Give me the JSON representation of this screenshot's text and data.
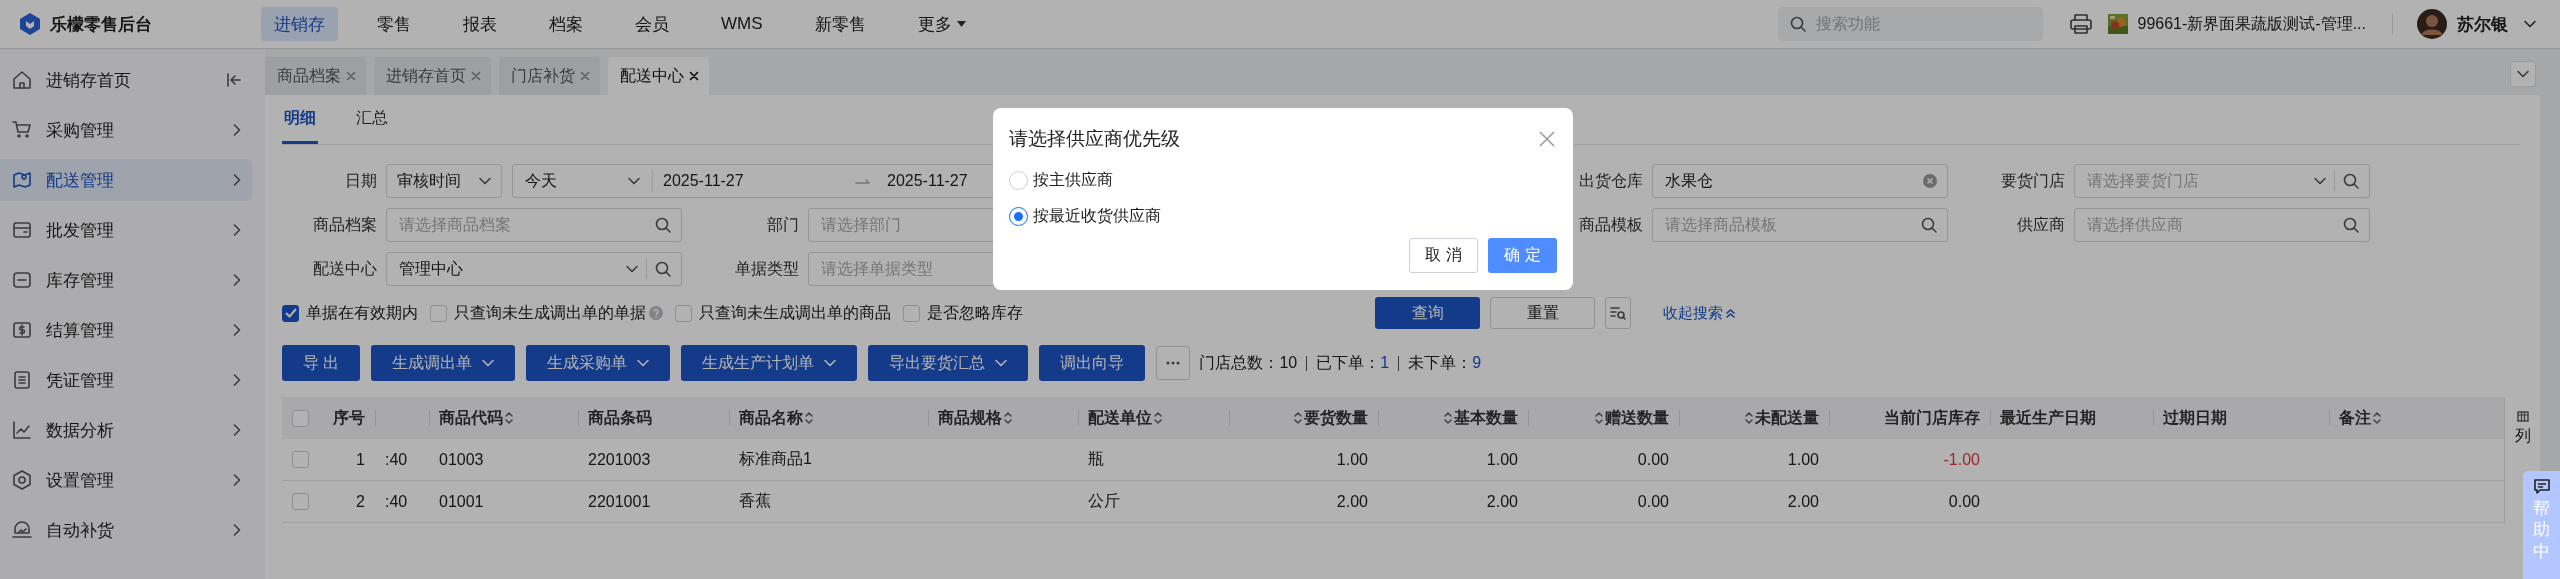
{
  "brand": {
    "name": "乐檬零售后台"
  },
  "top_nav": [
    {
      "label": "进销存",
      "selected": true,
      "caret": false
    },
    {
      "label": "零售",
      "selected": false,
      "caret": false
    },
    {
      "label": "报表",
      "selected": false,
      "caret": false
    },
    {
      "label": "档案",
      "selected": false,
      "caret": false
    },
    {
      "label": "会员",
      "selected": false,
      "caret": false
    },
    {
      "label": "WMS",
      "selected": false,
      "caret": false
    },
    {
      "label": "新零售",
      "selected": false,
      "caret": false
    },
    {
      "label": "更多",
      "selected": false,
      "caret": true
    }
  ],
  "search": {
    "placeholder": "搜索功能"
  },
  "store": {
    "name": "99661-新界面果蔬版测试-管理..."
  },
  "user": {
    "name": "苏尔银"
  },
  "sidebar": {
    "items": [
      {
        "label": "进销存首页",
        "selected": false,
        "kind": "home"
      },
      {
        "label": "采购管理",
        "selected": false,
        "kind": "cart"
      },
      {
        "label": "配送管理",
        "selected": true,
        "kind": "map"
      },
      {
        "label": "批发管理",
        "selected": false,
        "kind": "wallet"
      },
      {
        "label": "库存管理",
        "selected": false,
        "kind": "stock"
      },
      {
        "label": "结算管理",
        "selected": false,
        "kind": "money"
      },
      {
        "label": "凭证管理",
        "selected": false,
        "kind": "doc"
      },
      {
        "label": "数据分析",
        "selected": false,
        "kind": "chart"
      },
      {
        "label": "设置管理",
        "selected": false,
        "kind": "settings"
      },
      {
        "label": "自动补货",
        "selected": false,
        "kind": "auto"
      }
    ]
  },
  "page_tabs": [
    {
      "label": "商品档案",
      "selected": false
    },
    {
      "label": "进销存首页",
      "selected": false
    },
    {
      "label": "门店补货",
      "selected": false
    },
    {
      "label": "配送中心",
      "selected": true
    }
  ],
  "sub_tabs": [
    {
      "label": "明细",
      "selected": true
    },
    {
      "label": "汇总",
      "selected": false
    }
  ],
  "filter_rows": [
    {
      "left": [
        {
          "label": "日期",
          "kind": "date-range",
          "mode": "审核时间",
          "preset": "今天",
          "start": "2025-11-27",
          "end": "2025-11-27"
        }
      ],
      "right": [
        {
          "label": "出货仓库",
          "kind": "clearable",
          "value": "水果仓"
        },
        {
          "label": "要货门店",
          "kind": "select-search",
          "placeholder": "请选择要货门店"
        }
      ]
    },
    {
      "left": [
        {
          "label": "商品档案",
          "kind": "search",
          "placeholder": "请选择商品档案"
        },
        {
          "label": "部门",
          "kind": "text",
          "placeholder": "请选择部门"
        }
      ],
      "right": [
        {
          "label": "商品模板",
          "kind": "search",
          "placeholder": "请选择商品模板"
        },
        {
          "label": "供应商",
          "kind": "search",
          "placeholder": "请选择供应商"
        }
      ]
    },
    {
      "left": [
        {
          "label": "配送中心",
          "kind": "select-search",
          "value": "管理中心"
        },
        {
          "label": "单据类型",
          "kind": "text",
          "placeholder": "请选择单据类型"
        }
      ],
      "right": []
    }
  ],
  "options": [
    {
      "label": "单据在有效期内",
      "checked": true,
      "help": false
    },
    {
      "label": "只查询未生成调出单的单据",
      "checked": false,
      "help": true
    },
    {
      "label": "只查询未生成调出单的商品",
      "checked": false,
      "help": false
    },
    {
      "label": "是否忽略库存",
      "checked": false,
      "help": false
    }
  ],
  "search_actions": {
    "query": "查询",
    "reset": "重置",
    "collapse": "收起搜索"
  },
  "actions": [
    {
      "label": "导 出",
      "dropdown": false
    },
    {
      "label": "生成调出单",
      "dropdown": true
    },
    {
      "label": "生成采购单",
      "dropdown": true
    },
    {
      "label": "生成生产计划单",
      "dropdown": true
    },
    {
      "label": "导出要货汇总",
      "dropdown": true
    },
    {
      "label": "调出向导",
      "dropdown": false
    }
  ],
  "summary": [
    {
      "label": "门店总数：",
      "value": "10",
      "highlight": false
    },
    {
      "label": "已下单：",
      "value": "1",
      "highlight": true
    },
    {
      "label": "未下单：",
      "value": "9",
      "highlight": true
    }
  ],
  "table": {
    "select_all": {
      "checked": false
    },
    "columns": [
      {
        "label": "序号",
        "kind": "index",
        "sortable": false
      },
      {
        "kind": "text",
        "sortable": false
      },
      {
        "label": "商品代码",
        "kind": "text",
        "sortable": true
      },
      {
        "label": "商品条码",
        "kind": "text",
        "sortable": false
      },
      {
        "label": "商品名称",
        "kind": "text",
        "sortable": true
      },
      {
        "label": "商品规格",
        "kind": "text",
        "sortable": true
      },
      {
        "label": "配送单位",
        "kind": "text",
        "sortable": true
      },
      {
        "label": "要货数量",
        "kind": "number",
        "sortable": true
      },
      {
        "label": "基本数量",
        "kind": "number",
        "sortable": true
      },
      {
        "label": "赠送数量",
        "kind": "number",
        "sortable": true
      },
      {
        "label": "未配送量",
        "kind": "number",
        "sortable": true
      },
      {
        "label": "当前门店库存",
        "kind": "stock",
        "sortable": false
      },
      {
        "label": "最近生产日期",
        "kind": "text",
        "sortable": false
      },
      {
        "label": "过期日期",
        "kind": "text",
        "sortable": false
      },
      {
        "label": "备注",
        "kind": "text",
        "sortable": true
      }
    ],
    "rows": [
      {
        "checked": false,
        "stock_alert": true,
        "cells": [
          "1",
          ":40",
          "01003",
          "2201003",
          "标准商品1",
          null,
          "瓶",
          "1.00",
          "1.00",
          "0.00",
          "1.00",
          "-1.00",
          null,
          null,
          null
        ]
      },
      {
        "checked": false,
        "stock_alert": false,
        "cells": [
          "2",
          ":40",
          "01001",
          "2201001",
          "香蕉",
          null,
          "公斤",
          "2.00",
          "2.00",
          "0.00",
          "2.00",
          "0.00",
          null,
          null,
          null
        ]
      }
    ]
  },
  "column_button": {
    "label": "列"
  },
  "help": {
    "label": "帮助中"
  },
  "dialog": {
    "title": "请选择供应商优先级",
    "options": [
      {
        "label": "按主供应商",
        "selected": false
      },
      {
        "label": "按最近收货供应商",
        "selected": true
      }
    ],
    "cancel": "取 消",
    "confirm": "确 定"
  }
}
